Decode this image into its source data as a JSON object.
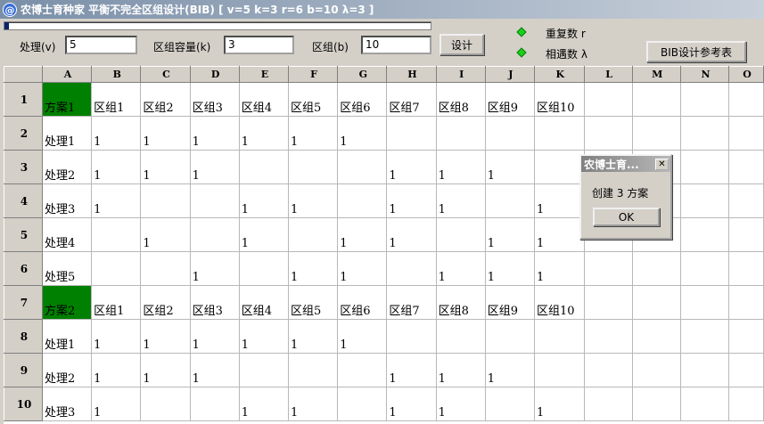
{
  "window": {
    "icon": "@",
    "title": "农博士育种家  平衡不完全区组设计(BIB) [ v=5 k=3 r=6 b=10 λ=3 ]"
  },
  "progress": {
    "fraction": 0.01
  },
  "controls": {
    "treatments_label": "处理(v)",
    "treatments_value": "5",
    "block_size_label": "区组容量(k)",
    "block_size_value": "3",
    "blocks_label": "区组(b)",
    "blocks_value": "10",
    "design_button": "设计",
    "replicates_label": "重复数 r",
    "meetings_label": "相遇数 λ",
    "reference_button": "BIB设计参考表"
  },
  "sheet": {
    "columns": [
      "A",
      "B",
      "C",
      "D",
      "E",
      "F",
      "G",
      "H",
      "I",
      "J",
      "K",
      "L",
      "M",
      "N",
      "O"
    ],
    "rows": [
      {
        "num": "1",
        "cells": [
          "方案1",
          "区组1",
          "区组2",
          "区组3",
          "区组4",
          "区组5",
          "区组6",
          "区组7",
          "区组8",
          "区组9",
          "区组10",
          "",
          "",
          "",
          ""
        ]
      },
      {
        "num": "2",
        "cells": [
          "处理1",
          "1",
          "1",
          "1",
          "1",
          "1",
          "1",
          "",
          "",
          "",
          "",
          "",
          "",
          "",
          ""
        ]
      },
      {
        "num": "3",
        "cells": [
          "处理2",
          "1",
          "1",
          "1",
          "",
          "",
          "",
          "1",
          "1",
          "1",
          "",
          "",
          "",
          "",
          ""
        ]
      },
      {
        "num": "4",
        "cells": [
          "处理3",
          "1",
          "",
          "",
          "1",
          "1",
          "",
          "1",
          "1",
          "",
          "1",
          "",
          "",
          "",
          ""
        ]
      },
      {
        "num": "5",
        "cells": [
          "处理4",
          "",
          "1",
          "",
          "1",
          "",
          "1",
          "1",
          "",
          "1",
          "1",
          "",
          "",
          "",
          ""
        ]
      },
      {
        "num": "6",
        "cells": [
          "处理5",
          "",
          "",
          "1",
          "",
          "1",
          "1",
          "",
          "1",
          "1",
          "1",
          "",
          "",
          "",
          ""
        ]
      },
      {
        "num": "7",
        "cells": [
          "方案2",
          "区组1",
          "区组2",
          "区组3",
          "区组4",
          "区组5",
          "区组6",
          "区组7",
          "区组8",
          "区组9",
          "区组10",
          "",
          "",
          "",
          ""
        ]
      },
      {
        "num": "8",
        "cells": [
          "处理1",
          "1",
          "1",
          "1",
          "1",
          "1",
          "1",
          "",
          "",
          "",
          "",
          "",
          "",
          "",
          ""
        ]
      },
      {
        "num": "9",
        "cells": [
          "处理2",
          "1",
          "1",
          "1",
          "",
          "",
          "",
          "1",
          "1",
          "1",
          "",
          "",
          "",
          "",
          ""
        ]
      },
      {
        "num": "10",
        "cells": [
          "处理3",
          "1",
          "",
          "",
          "1",
          "1",
          "",
          "1",
          "1",
          "",
          "1",
          "",
          "",
          "",
          ""
        ]
      }
    ]
  },
  "dialog": {
    "title": "农博士育...",
    "message": "创建 3 方案",
    "ok_label": "OK"
  },
  "colors": {
    "highlight_cell": "#008000",
    "indicator": "#19d219"
  }
}
